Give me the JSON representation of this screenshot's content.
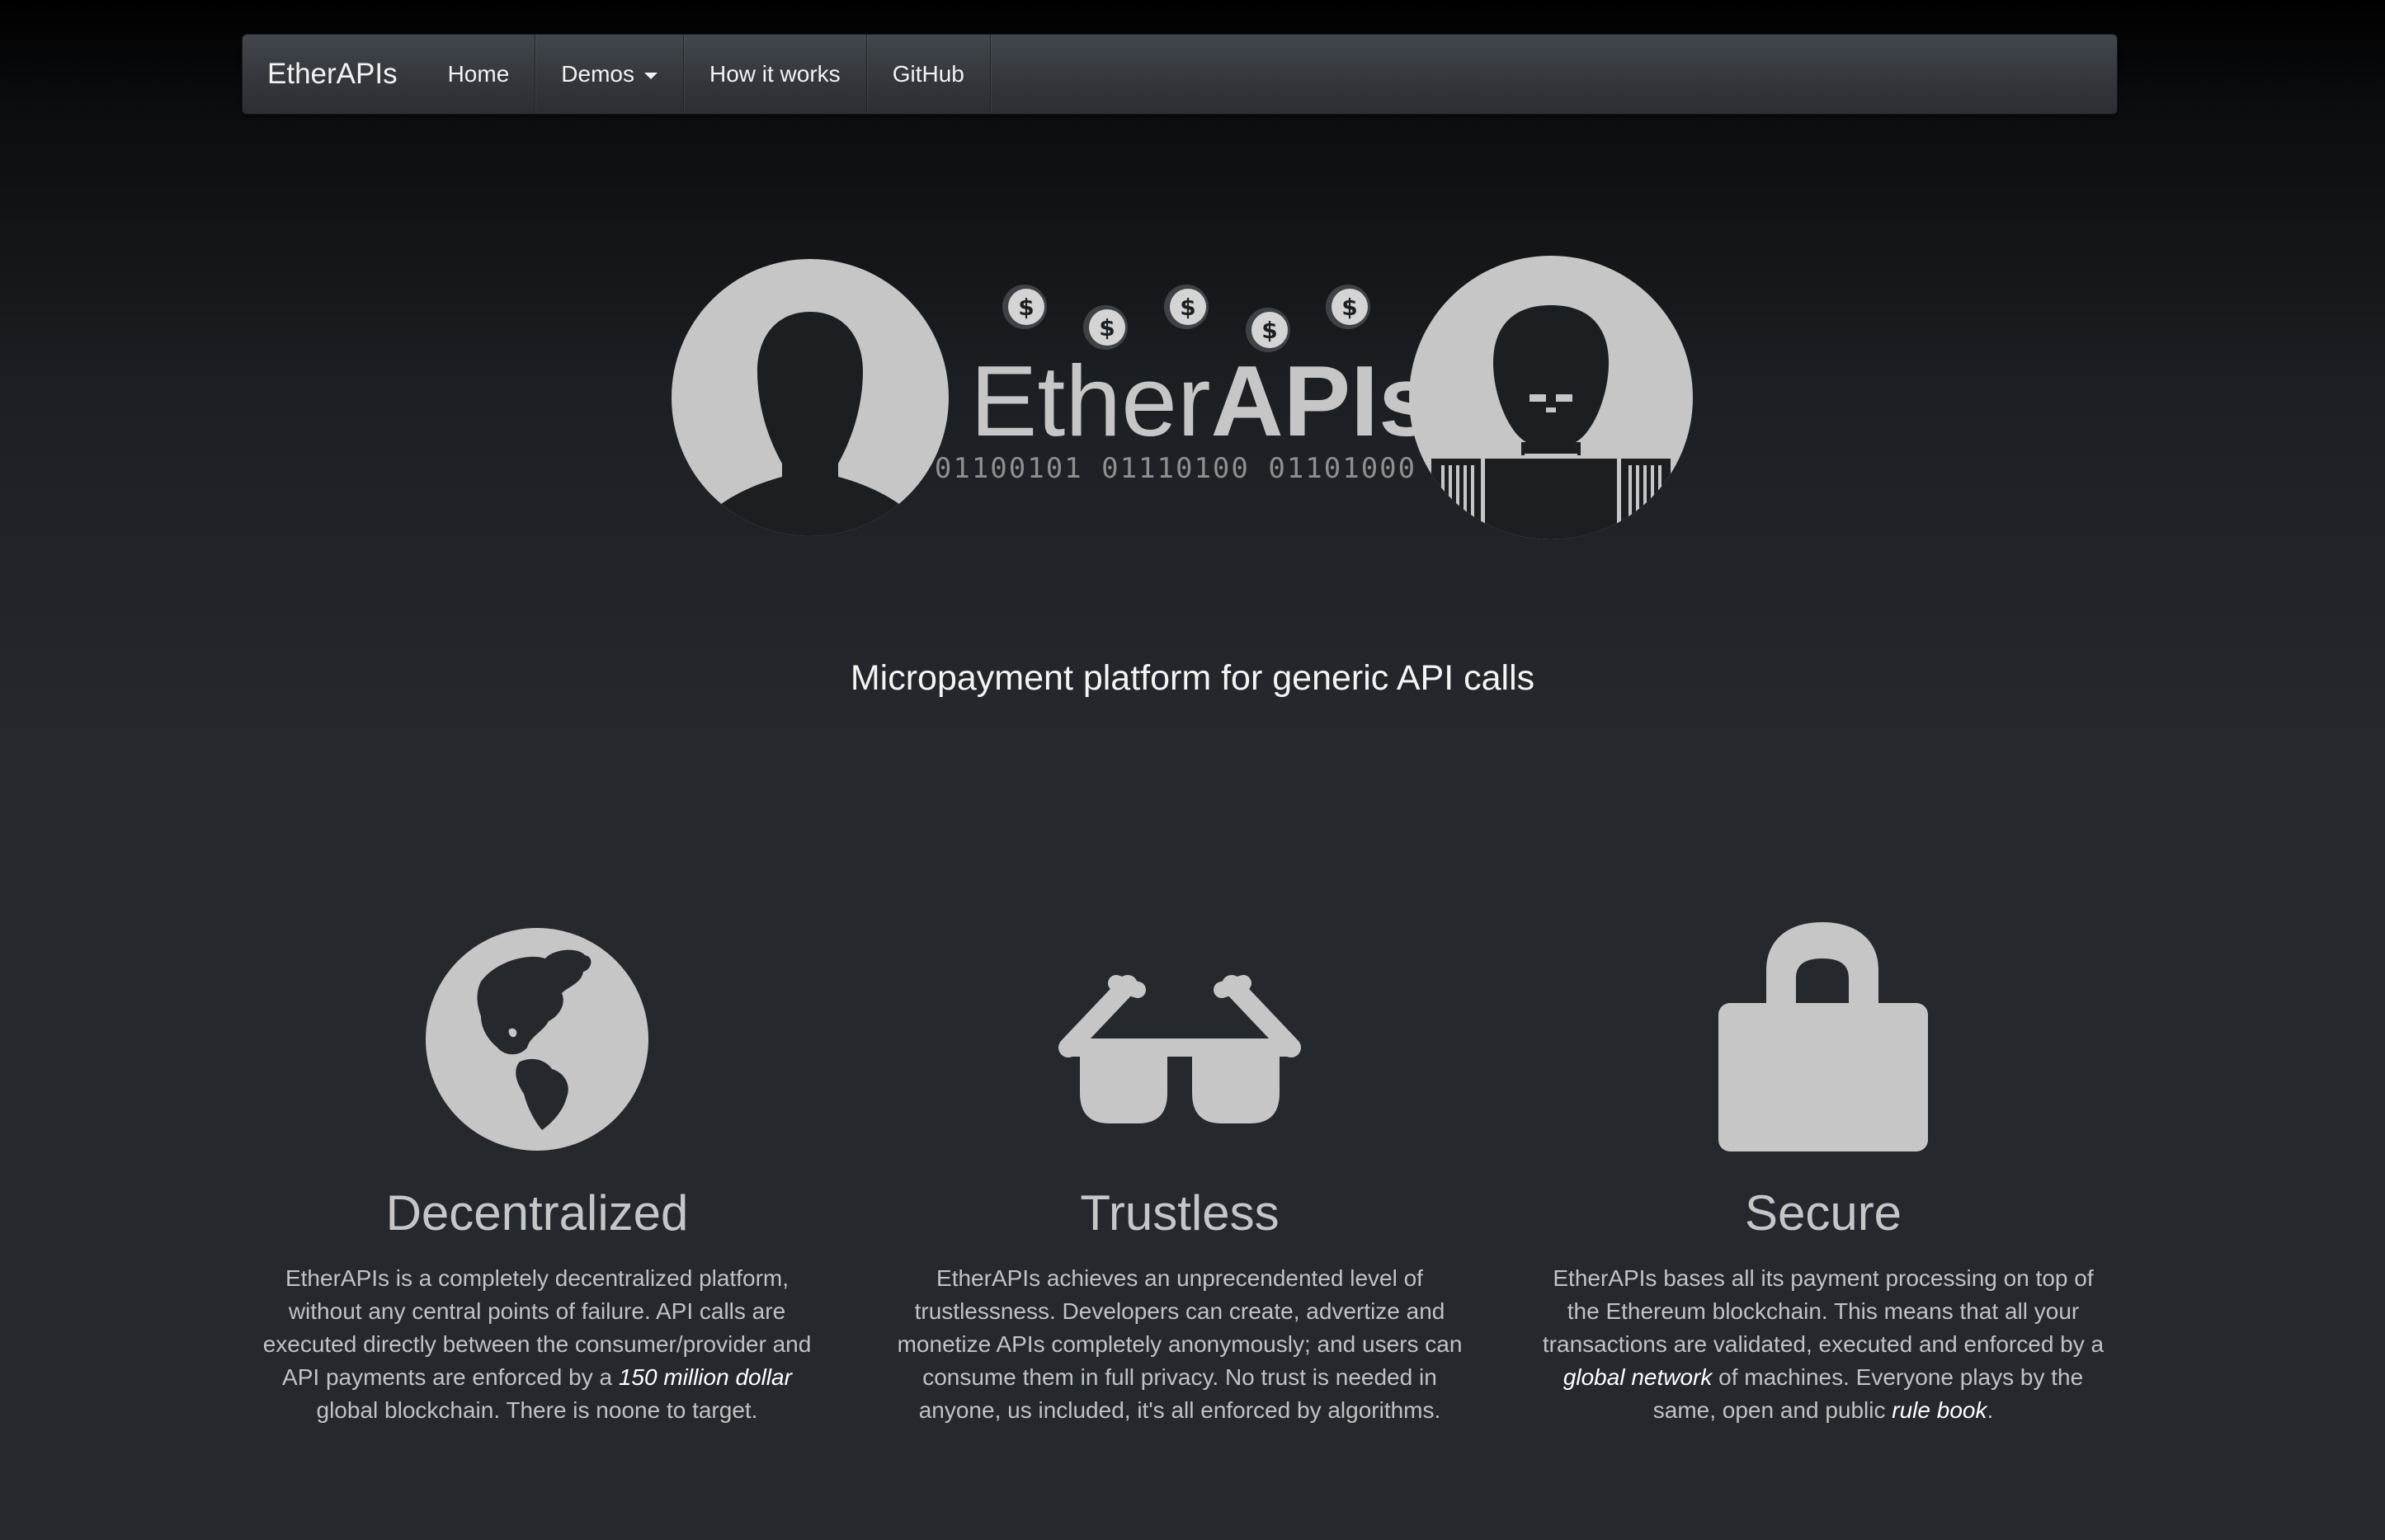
{
  "navbar": {
    "brand": "EtherAPIs",
    "items": [
      {
        "label": "Home"
      },
      {
        "label": "Demos"
      },
      {
        "label": "How it works"
      },
      {
        "label": "GitHub"
      }
    ]
  },
  "hero": {
    "logo_text_light": "Ether",
    "logo_text_bold": "APIs",
    "binary": "01100101 01110100 01101000",
    "coin_symbol": "$",
    "tagline": "Micropayment platform for generic API calls"
  },
  "features": [
    {
      "icon": "globe-icon",
      "title": "Decentralized",
      "body_parts": [
        "EtherAPIs is a completely decentralized platform, without any central points of failure. API calls are executed directly between the consumer/provider and API payments are enforced by a ",
        "150 million dollar",
        " global blockchain. There is noone to target."
      ]
    },
    {
      "icon": "sunglasses-icon",
      "title": "Trustless",
      "body_parts": [
        "EtherAPIs achieves an unprecendented level of trustlessness. Developers can create, advertize and monetize APIs completely anonymously; and users can consume them in full privacy. No trust is needed in anyone, us included, it's all enforced by algorithms."
      ]
    },
    {
      "icon": "lock-icon",
      "title": "Secure",
      "body_parts": [
        "EtherAPIs bases all its payment processing on top of the Ethereum blockchain. This means that all your transactions are validated, executed and enforced by a ",
        "global network",
        " of machines. Everyone plays by the same, open and public ",
        "rule book",
        "."
      ]
    }
  ],
  "colors": {
    "icon": "#c6c6c6",
    "accent_text": "#ffffff"
  }
}
